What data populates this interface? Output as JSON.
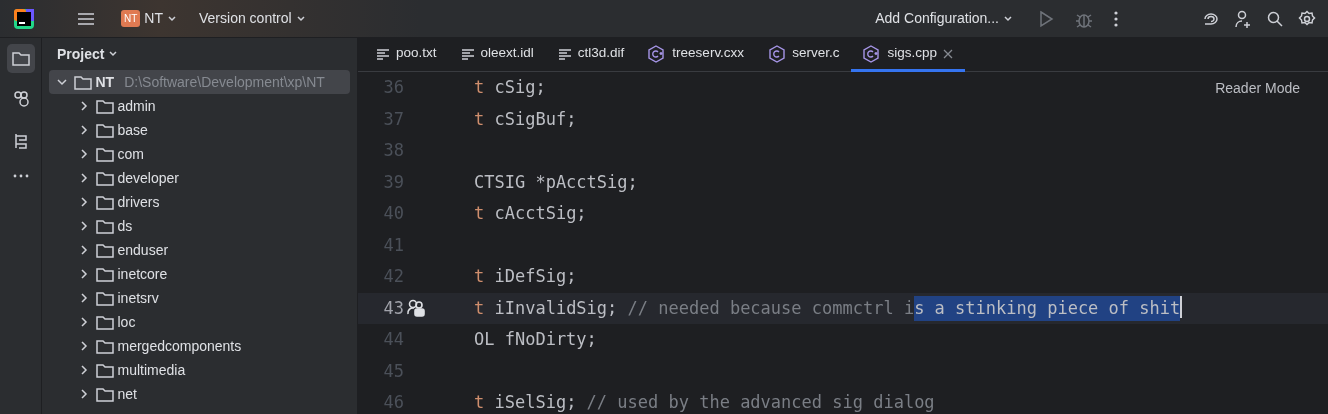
{
  "toolbar": {
    "project_badge": "NT",
    "project": "NT",
    "vcs": "Version control",
    "run_config": "Add Configuration..."
  },
  "project_panel": {
    "title": "Project",
    "root": {
      "name": "NT",
      "path": "D:\\Software\\Development\\xp\\NT",
      "expanded": true,
      "selected": true,
      "children": [
        {
          "name": "admin",
          "expanded": false
        },
        {
          "name": "base",
          "expanded": false
        },
        {
          "name": "com",
          "expanded": false
        },
        {
          "name": "developer",
          "expanded": false
        },
        {
          "name": "drivers",
          "expanded": false
        },
        {
          "name": "ds",
          "expanded": false
        },
        {
          "name": "enduser",
          "expanded": false
        },
        {
          "name": "inetcore",
          "expanded": false
        },
        {
          "name": "inetsrv",
          "expanded": false
        },
        {
          "name": "loc",
          "expanded": false
        },
        {
          "name": "mergedcomponents",
          "expanded": false
        },
        {
          "name": "multimedia",
          "expanded": false
        },
        {
          "name": "net",
          "expanded": false
        }
      ]
    }
  },
  "tabs": [
    {
      "label": "poo.txt",
      "kind": "text",
      "selected": false
    },
    {
      "label": "oleext.idl",
      "kind": "text",
      "selected": false
    },
    {
      "label": "ctl3d.dif",
      "kind": "text",
      "selected": false
    },
    {
      "label": "treeserv.cxx",
      "kind": "cpp",
      "selected": false
    },
    {
      "label": "server.c",
      "kind": "c",
      "selected": false
    },
    {
      "label": "sigs.cpp",
      "kind": "cpp",
      "selected": true
    }
  ],
  "editor": {
    "reader_mode": "Reader Mode",
    "lines": [
      {
        "number": "36",
        "current": false,
        "tokens": [
          {
            "text": "t",
            "kind": "keyword"
          },
          {
            "text": " cSig;",
            "kind": "plain"
          }
        ]
      },
      {
        "number": "37",
        "current": false,
        "tokens": [
          {
            "text": "t",
            "kind": "keyword"
          },
          {
            "text": " cSigBuf;",
            "kind": "plain"
          }
        ]
      },
      {
        "number": "38",
        "current": false
      },
      {
        "number": "39",
        "current": false,
        "tokens": [
          {
            "text": "CTSIG *pAcctSig;",
            "kind": "plain"
          }
        ]
      },
      {
        "number": "40",
        "current": false,
        "tokens": [
          {
            "text": "t",
            "kind": "keyword"
          },
          {
            "text": " cAcctSig;",
            "kind": "plain"
          }
        ]
      },
      {
        "number": "41",
        "current": false
      },
      {
        "number": "42",
        "current": false,
        "tokens": [
          {
            "text": "t",
            "kind": "keyword"
          },
          {
            "text": " iDefSig;",
            "kind": "plain"
          }
        ]
      },
      {
        "number": "43",
        "current": true,
        "tokens": [
          {
            "text": "t",
            "kind": "keyword"
          },
          {
            "text": " iInvalidSig; ",
            "kind": "plain"
          },
          {
            "text": "// needed because commctrl i",
            "kind": "comment"
          },
          {
            "text": "s a stinking piece of shit",
            "kind": "comment",
            "selected": true
          }
        ]
      },
      {
        "number": "44",
        "current": false,
        "tokens": [
          {
            "text": "OL fNoDirty;",
            "kind": "plain"
          }
        ]
      },
      {
        "number": "45",
        "current": false
      },
      {
        "number": "46",
        "current": false,
        "tokens": [
          {
            "text": "t",
            "kind": "keyword"
          },
          {
            "text": " iSelSig; ",
            "kind": "plain"
          },
          {
            "text": "// used by the advanced sig dialog",
            "kind": "comment"
          }
        ]
      }
    ]
  }
}
